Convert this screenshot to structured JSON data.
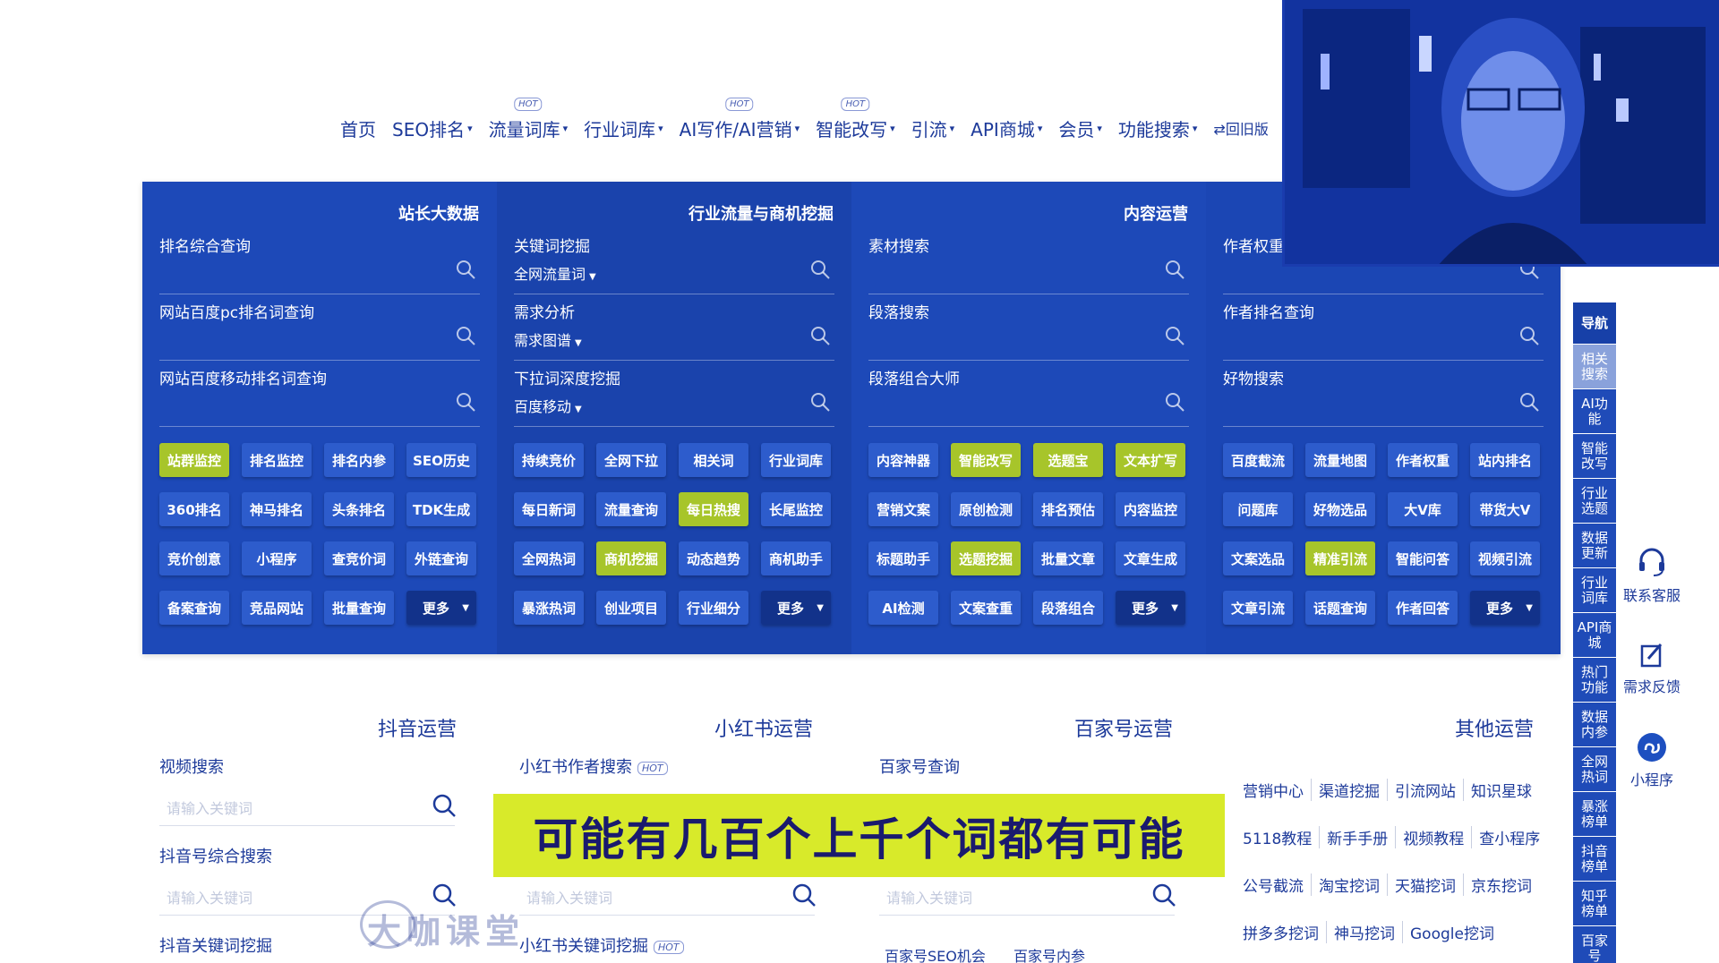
{
  "nav": {
    "items": [
      {
        "label": "首页",
        "caret": false,
        "hot": false
      },
      {
        "label": "SEO排名",
        "caret": true,
        "hot": false
      },
      {
        "label": "流量词库",
        "caret": true,
        "hot": true
      },
      {
        "label": "行业词库",
        "caret": true,
        "hot": false
      },
      {
        "label": "AI写作/AI营销",
        "caret": true,
        "hot": true
      },
      {
        "label": "智能改写",
        "caret": true,
        "hot": true
      },
      {
        "label": "引流",
        "caret": true,
        "hot": false
      },
      {
        "label": "API商城",
        "caret": true,
        "hot": false
      },
      {
        "label": "会员",
        "caret": true,
        "hot": false
      },
      {
        "label": "功能搜索",
        "caret": true,
        "hot": false
      }
    ],
    "back_old": "⇄回旧版",
    "hot_label": "HOT"
  },
  "panel": {
    "columns": [
      {
        "title": "站长大数据",
        "searches": [
          {
            "label": "排名综合查询",
            "sub": ""
          },
          {
            "label": "网站百度pc排名词查询",
            "sub": ""
          },
          {
            "label": "网站百度移动排名词查询",
            "sub": ""
          }
        ],
        "buttons": [
          {
            "label": "站群监控",
            "style": "green"
          },
          {
            "label": "排名监控",
            "style": ""
          },
          {
            "label": "排名内参",
            "style": ""
          },
          {
            "label": "SEO历史",
            "style": ""
          },
          {
            "label": "360排名",
            "style": ""
          },
          {
            "label": "神马排名",
            "style": ""
          },
          {
            "label": "头条排名",
            "style": ""
          },
          {
            "label": "TDK生成",
            "style": ""
          },
          {
            "label": "竞价创意",
            "style": ""
          },
          {
            "label": "小程序",
            "style": ""
          },
          {
            "label": "查竞价词",
            "style": ""
          },
          {
            "label": "外链查询",
            "style": ""
          },
          {
            "label": "备案查询",
            "style": ""
          },
          {
            "label": "竞品网站",
            "style": ""
          },
          {
            "label": "批量查询",
            "style": ""
          },
          {
            "label": "更多",
            "style": "dark"
          }
        ]
      },
      {
        "title": "行业流量与商机挖掘",
        "searches": [
          {
            "label": "关键词挖掘",
            "sub": "全网流量词"
          },
          {
            "label": "需求分析",
            "sub": "需求图谱"
          },
          {
            "label": "下拉词深度挖掘",
            "sub": "百度移动"
          }
        ],
        "buttons": [
          {
            "label": "持续竞价",
            "style": ""
          },
          {
            "label": "全网下拉",
            "style": ""
          },
          {
            "label": "相关词",
            "style": ""
          },
          {
            "label": "行业词库",
            "style": ""
          },
          {
            "label": "每日新词",
            "style": ""
          },
          {
            "label": "流量查询",
            "style": ""
          },
          {
            "label": "每日热搜",
            "style": "green"
          },
          {
            "label": "长尾监控",
            "style": ""
          },
          {
            "label": "全网热词",
            "style": ""
          },
          {
            "label": "商机挖掘",
            "style": "green"
          },
          {
            "label": "动态趋势",
            "style": ""
          },
          {
            "label": "商机助手",
            "style": ""
          },
          {
            "label": "暴涨热词",
            "style": ""
          },
          {
            "label": "创业项目",
            "style": ""
          },
          {
            "label": "行业细分",
            "style": ""
          },
          {
            "label": "更多",
            "style": "dark"
          }
        ]
      },
      {
        "title": "内容运营",
        "searches": [
          {
            "label": "素材搜索",
            "sub": ""
          },
          {
            "label": "段落搜索",
            "sub": ""
          },
          {
            "label": "段落组合大师",
            "sub": ""
          }
        ],
        "buttons": [
          {
            "label": "内容神器",
            "style": ""
          },
          {
            "label": "智能改写",
            "style": "green"
          },
          {
            "label": "选题宝",
            "style": "green"
          },
          {
            "label": "文本扩写",
            "style": "green"
          },
          {
            "label": "营销文案",
            "style": ""
          },
          {
            "label": "原创检测",
            "style": ""
          },
          {
            "label": "排名预估",
            "style": ""
          },
          {
            "label": "内容监控",
            "style": ""
          },
          {
            "label": "标题助手",
            "style": ""
          },
          {
            "label": "选题挖掘",
            "style": "green"
          },
          {
            "label": "批量文章",
            "style": ""
          },
          {
            "label": "文章生成",
            "style": ""
          },
          {
            "label": "AI检测",
            "style": ""
          },
          {
            "label": "文案查重",
            "style": ""
          },
          {
            "label": "段落组合",
            "style": ""
          },
          {
            "label": "更多",
            "style": "dark"
          }
        ]
      },
      {
        "title": "",
        "searches": [
          {
            "label": "作者权重",
            "sub": ""
          },
          {
            "label": "作者排名查询",
            "sub": ""
          },
          {
            "label": "好物搜索",
            "sub": ""
          }
        ],
        "buttons": [
          {
            "label": "百度截流",
            "style": ""
          },
          {
            "label": "流量地图",
            "style": ""
          },
          {
            "label": "作者权重",
            "style": ""
          },
          {
            "label": "站内排名",
            "style": ""
          },
          {
            "label": "问题库",
            "style": ""
          },
          {
            "label": "好物选品",
            "style": ""
          },
          {
            "label": "大V库",
            "style": ""
          },
          {
            "label": "带货大V",
            "style": ""
          },
          {
            "label": "文案选品",
            "style": ""
          },
          {
            "label": "精准引流",
            "style": "green"
          },
          {
            "label": "智能问答",
            "style": ""
          },
          {
            "label": "视频引流",
            "style": ""
          },
          {
            "label": "文章引流",
            "style": ""
          },
          {
            "label": "话题查询",
            "style": ""
          },
          {
            "label": "作者回答",
            "style": ""
          },
          {
            "label": "更多",
            "style": "dark"
          }
        ]
      }
    ]
  },
  "lower": {
    "douyin": {
      "title": "抖音运营",
      "label1": "视频搜索",
      "placeholder1": "请输入关键词",
      "label2": "抖音号综合搜索",
      "placeholder2": "请输入关键词",
      "label3": "抖音关键词挖掘"
    },
    "xiaohongshu": {
      "title": "小红书运营",
      "label1": "小红书作者搜索",
      "placeholder2": "请输入关键词",
      "label3": "小红书关键词挖掘"
    },
    "baijiahao": {
      "title": "百家号运营",
      "label1": "百家号查询",
      "placeholder2": "请输入关键词",
      "link_a": "百家号SEO机会",
      "link_b": "百家号内参"
    },
    "other": {
      "title": "其他运营",
      "rows": [
        [
          "营销中心",
          "渠道挖掘",
          "引流网站",
          "知识星球"
        ],
        [
          "5118教程",
          "新手手册",
          "视频教程",
          "查小程序"
        ],
        [
          "公号截流",
          "淘宝挖词",
          "天猫挖词",
          "京东挖词"
        ],
        [
          "拼多多挖词",
          "神马挖词",
          "Google挖词"
        ]
      ]
    }
  },
  "subtitle": "可能有几百个上千个词都有可能",
  "watermark": "大咖课堂",
  "sidenav": {
    "head": "导航",
    "items": [
      "相关搜索",
      "AI功能",
      "智能改写",
      "行业选题",
      "数据更新",
      "行业词库",
      "API商城",
      "热门功能",
      "数据内参",
      "全网热词",
      "暴涨榜单",
      "抖音榜单",
      "知乎榜单",
      "百家号"
    ]
  },
  "tools": {
    "service": "联系客服",
    "feedback": "需求反馈",
    "miniapp": "小程序"
  },
  "colors": {
    "panel_blue": "#1d49b8",
    "button_blue": "#2d5ccc",
    "button_green": "#a7c52a",
    "button_dark": "#12328a",
    "subtitle_bg": "#d8ea2a",
    "link_blue": "#1d3a9a"
  },
  "icons": {
    "search": "magnifier-icon",
    "service": "headset-icon",
    "feedback": "edit-icon",
    "miniapp": "miniapp-icon"
  }
}
